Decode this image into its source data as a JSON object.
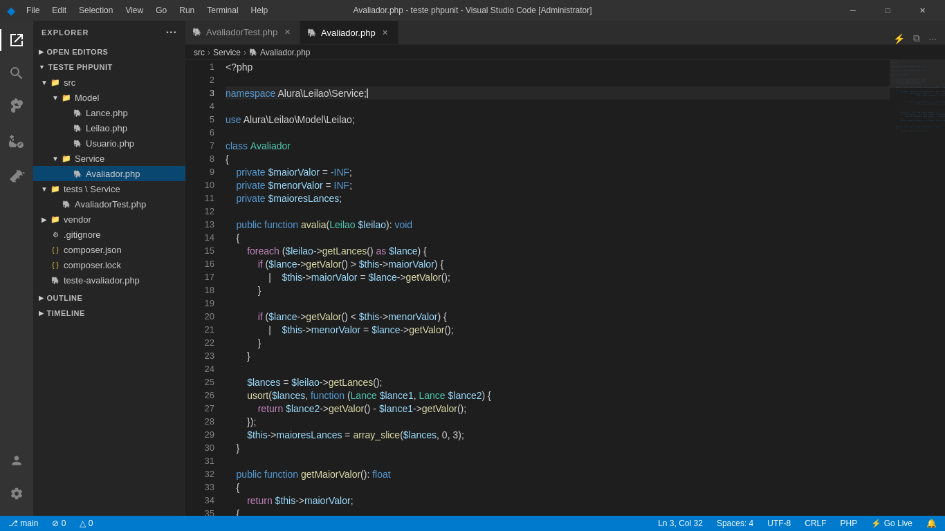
{
  "titleBar": {
    "title": "Avaliador.php - teste phpunit - Visual Studio Code [Administrator]",
    "menus": [
      "File",
      "Edit",
      "Selection",
      "View",
      "Go",
      "Run",
      "Terminal",
      "Help"
    ],
    "winButtons": [
      "─",
      "□",
      "✕"
    ]
  },
  "sidebar": {
    "header": "Explorer",
    "headerDots": "···",
    "sections": {
      "openEditors": "Open Editors",
      "project": "TESTE PHPUNIT"
    },
    "openEditorFiles": [
      {
        "name": "AvaliadorTest.php",
        "icon": "php"
      },
      {
        "name": "Avaliador.php",
        "icon": "php",
        "active": true
      }
    ],
    "tree": [
      {
        "indent": 0,
        "type": "folder",
        "open": true,
        "name": "src"
      },
      {
        "indent": 1,
        "type": "folder",
        "open": true,
        "name": "Model"
      },
      {
        "indent": 2,
        "type": "file",
        "name": "Lance.php",
        "icon": "php"
      },
      {
        "indent": 2,
        "type": "file",
        "name": "Leilao.php",
        "icon": "php"
      },
      {
        "indent": 2,
        "type": "file",
        "name": "Usuario.php",
        "icon": "php"
      },
      {
        "indent": 1,
        "type": "folder",
        "open": true,
        "name": "Service"
      },
      {
        "indent": 2,
        "type": "file",
        "name": "Avaliador.php",
        "icon": "php",
        "selected": true
      },
      {
        "indent": 0,
        "type": "folder",
        "open": true,
        "name": "tests \\ Service"
      },
      {
        "indent": 1,
        "type": "file",
        "name": "AvaliadorTest.php",
        "icon": "php"
      },
      {
        "indent": 0,
        "type": "folder",
        "open": false,
        "name": "vendor"
      },
      {
        "indent": 0,
        "type": "file",
        "name": ".gitignore",
        "icon": "git"
      },
      {
        "indent": 0,
        "type": "file",
        "name": "composer.json",
        "icon": "json"
      },
      {
        "indent": 0,
        "type": "file",
        "name": "composer.lock",
        "icon": "json"
      },
      {
        "indent": 0,
        "type": "file",
        "name": "teste-avaliador.php",
        "icon": "php"
      }
    ],
    "outlineSection": "Outline",
    "timelineSection": "Timeline"
  },
  "tabs": [
    {
      "name": "AvaliadorTest.php",
      "icon": "php",
      "active": false
    },
    {
      "name": "Avaliador.php",
      "icon": "php",
      "active": true,
      "modified": false
    }
  ],
  "breadcrumb": {
    "parts": [
      "src",
      "Service",
      "Avaliador.php"
    ]
  },
  "editor": {
    "filename": "Avaliador.php",
    "lines": [
      {
        "num": 1,
        "code": [
          {
            "t": "plain",
            "v": "<?php"
          }
        ]
      },
      {
        "num": 2,
        "code": []
      },
      {
        "num": 3,
        "code": [
          {
            "t": "kw",
            "v": "namespace"
          },
          {
            "t": "plain",
            "v": " Alura\\Leilao\\Service;"
          },
          {
            "t": "cursor",
            "v": ""
          }
        ]
      },
      {
        "num": 4,
        "code": []
      },
      {
        "num": 5,
        "code": [
          {
            "t": "kw",
            "v": "use"
          },
          {
            "t": "plain",
            "v": " Alura\\Leilao\\Model\\Leilao;"
          }
        ]
      },
      {
        "num": 6,
        "code": []
      },
      {
        "num": 7,
        "code": [
          {
            "t": "kw",
            "v": "class"
          },
          {
            "t": "plain",
            "v": " "
          },
          {
            "t": "cls",
            "v": "Avaliador"
          }
        ]
      },
      {
        "num": 8,
        "code": [
          {
            "t": "plain",
            "v": "{"
          }
        ]
      },
      {
        "num": 9,
        "code": [
          {
            "t": "plain",
            "v": "    "
          },
          {
            "t": "kw",
            "v": "private"
          },
          {
            "t": "plain",
            "v": " "
          },
          {
            "t": "var",
            "v": "$maiorValor"
          },
          {
            "t": "plain",
            "v": " = "
          },
          {
            "t": "kw",
            "v": "-INF"
          },
          {
            "t": "plain",
            "v": ";"
          }
        ]
      },
      {
        "num": 10,
        "code": [
          {
            "t": "plain",
            "v": "    "
          },
          {
            "t": "kw",
            "v": "private"
          },
          {
            "t": "plain",
            "v": " "
          },
          {
            "t": "var",
            "v": "$menorValor"
          },
          {
            "t": "plain",
            "v": " = "
          },
          {
            "t": "kw",
            "v": "INF"
          },
          {
            "t": "plain",
            "v": ";"
          }
        ]
      },
      {
        "num": 11,
        "code": [
          {
            "t": "plain",
            "v": "    "
          },
          {
            "t": "kw",
            "v": "private"
          },
          {
            "t": "plain",
            "v": " "
          },
          {
            "t": "var",
            "v": "$maioresLances"
          },
          {
            "t": "plain",
            "v": ";"
          }
        ]
      },
      {
        "num": 12,
        "code": []
      },
      {
        "num": 13,
        "code": [
          {
            "t": "plain",
            "v": "    "
          },
          {
            "t": "kw",
            "v": "public"
          },
          {
            "t": "plain",
            "v": " "
          },
          {
            "t": "kw",
            "v": "function"
          },
          {
            "t": "plain",
            "v": " "
          },
          {
            "t": "fn",
            "v": "avalia"
          },
          {
            "t": "plain",
            "v": "("
          },
          {
            "t": "cls",
            "v": "Leilao"
          },
          {
            "t": "plain",
            "v": " "
          },
          {
            "t": "var",
            "v": "$leilao"
          },
          {
            "t": "plain",
            "v": "): "
          },
          {
            "t": "kw",
            "v": "void"
          }
        ]
      },
      {
        "num": 14,
        "code": [
          {
            "t": "plain",
            "v": "    {"
          }
        ]
      },
      {
        "num": 15,
        "code": [
          {
            "t": "plain",
            "v": "        "
          },
          {
            "t": "kw2",
            "v": "foreach"
          },
          {
            "t": "plain",
            "v": " ("
          },
          {
            "t": "var",
            "v": "$leilao"
          },
          {
            "t": "plain",
            "v": "->"
          },
          {
            "t": "fn",
            "v": "getLances"
          },
          {
            "t": "plain",
            "v": "() "
          },
          {
            "t": "kw2",
            "v": "as"
          },
          {
            "t": "plain",
            "v": " "
          },
          {
            "t": "var",
            "v": "$lance"
          },
          {
            "t": "plain",
            "v": ") {"
          }
        ]
      },
      {
        "num": 16,
        "code": [
          {
            "t": "plain",
            "v": "            "
          },
          {
            "t": "kw2",
            "v": "if"
          },
          {
            "t": "plain",
            "v": " ("
          },
          {
            "t": "var",
            "v": "$lance"
          },
          {
            "t": "plain",
            "v": "->"
          },
          {
            "t": "fn",
            "v": "getValor"
          },
          {
            "t": "plain",
            "v": "() > "
          },
          {
            "t": "var",
            "v": "$this"
          },
          {
            "t": "plain",
            "v": "->"
          },
          {
            "t": "var",
            "v": "maiorValor"
          },
          {
            "t": "plain",
            "v": ") {"
          }
        ]
      },
      {
        "num": 17,
        "code": [
          {
            "t": "plain",
            "v": "                |    "
          },
          {
            "t": "var",
            "v": "$this"
          },
          {
            "t": "plain",
            "v": "->"
          },
          {
            "t": "var",
            "v": "maiorValor"
          },
          {
            "t": "plain",
            "v": " = "
          },
          {
            "t": "var",
            "v": "$lance"
          },
          {
            "t": "plain",
            "v": "->"
          },
          {
            "t": "fn",
            "v": "getValor"
          },
          {
            "t": "plain",
            "v": "();"
          }
        ]
      },
      {
        "num": 18,
        "code": [
          {
            "t": "plain",
            "v": "            }"
          }
        ]
      },
      {
        "num": 19,
        "code": []
      },
      {
        "num": 20,
        "code": [
          {
            "t": "plain",
            "v": "            "
          },
          {
            "t": "kw2",
            "v": "if"
          },
          {
            "t": "plain",
            "v": " ("
          },
          {
            "t": "var",
            "v": "$lance"
          },
          {
            "t": "plain",
            "v": "->"
          },
          {
            "t": "fn",
            "v": "getValor"
          },
          {
            "t": "plain",
            "v": "() < "
          },
          {
            "t": "var",
            "v": "$this"
          },
          {
            "t": "plain",
            "v": "->"
          },
          {
            "t": "var",
            "v": "menorValor"
          },
          {
            "t": "plain",
            "v": ") {"
          }
        ]
      },
      {
        "num": 21,
        "code": [
          {
            "t": "plain",
            "v": "                |    "
          },
          {
            "t": "var",
            "v": "$this"
          },
          {
            "t": "plain",
            "v": "->"
          },
          {
            "t": "var",
            "v": "menorValor"
          },
          {
            "t": "plain",
            "v": " = "
          },
          {
            "t": "var",
            "v": "$lance"
          },
          {
            "t": "plain",
            "v": "->"
          },
          {
            "t": "fn",
            "v": "getValor"
          },
          {
            "t": "plain",
            "v": "();"
          }
        ]
      },
      {
        "num": 22,
        "code": [
          {
            "t": "plain",
            "v": "            }"
          }
        ]
      },
      {
        "num": 23,
        "code": [
          {
            "t": "plain",
            "v": "        }"
          }
        ]
      },
      {
        "num": 24,
        "code": []
      },
      {
        "num": 25,
        "code": [
          {
            "t": "plain",
            "v": "        "
          },
          {
            "t": "var",
            "v": "$lances"
          },
          {
            "t": "plain",
            "v": " = "
          },
          {
            "t": "var",
            "v": "$leilao"
          },
          {
            "t": "plain",
            "v": "->"
          },
          {
            "t": "fn",
            "v": "getLances"
          },
          {
            "t": "plain",
            "v": "();"
          }
        ]
      },
      {
        "num": 26,
        "code": [
          {
            "t": "plain",
            "v": "        "
          },
          {
            "t": "fn",
            "v": "usort"
          },
          {
            "t": "plain",
            "v": "("
          },
          {
            "t": "var",
            "v": "$lances"
          },
          {
            "t": "plain",
            "v": ", "
          },
          {
            "t": "kw",
            "v": "function"
          },
          {
            "t": "plain",
            "v": " ("
          },
          {
            "t": "cls",
            "v": "Lance"
          },
          {
            "t": "plain",
            "v": " "
          },
          {
            "t": "var",
            "v": "$lance1"
          },
          {
            "t": "plain",
            "v": ", "
          },
          {
            "t": "cls",
            "v": "Lance"
          },
          {
            "t": "plain",
            "v": " "
          },
          {
            "t": "var",
            "v": "$lance2"
          },
          {
            "t": "plain",
            "v": ") {"
          }
        ]
      },
      {
        "num": 27,
        "code": [
          {
            "t": "plain",
            "v": "            "
          },
          {
            "t": "kw2",
            "v": "return"
          },
          {
            "t": "plain",
            "v": " "
          },
          {
            "t": "var",
            "v": "$lance2"
          },
          {
            "t": "plain",
            "v": "->"
          },
          {
            "t": "fn",
            "v": "getValor"
          },
          {
            "t": "plain",
            "v": "() - "
          },
          {
            "t": "var",
            "v": "$lance1"
          },
          {
            "t": "plain",
            "v": "->"
          },
          {
            "t": "fn",
            "v": "getValor"
          },
          {
            "t": "plain",
            "v": "();"
          }
        ]
      },
      {
        "num": 28,
        "code": [
          {
            "t": "plain",
            "v": "        });"
          }
        ]
      },
      {
        "num": 29,
        "code": [
          {
            "t": "plain",
            "v": "        "
          },
          {
            "t": "var",
            "v": "$this"
          },
          {
            "t": "plain",
            "v": "->"
          },
          {
            "t": "var",
            "v": "maioresLances"
          },
          {
            "t": "plain",
            "v": " = "
          },
          {
            "t": "fn",
            "v": "array_slice"
          },
          {
            "t": "plain",
            "v": "("
          },
          {
            "t": "var",
            "v": "$lances"
          },
          {
            "t": "plain",
            "v": ", 0, 3);"
          }
        ]
      },
      {
        "num": 30,
        "code": [
          {
            "t": "plain",
            "v": "    }"
          }
        ]
      },
      {
        "num": 31,
        "code": []
      },
      {
        "num": 32,
        "code": [
          {
            "t": "plain",
            "v": "    "
          },
          {
            "t": "kw",
            "v": "public"
          },
          {
            "t": "plain",
            "v": " "
          },
          {
            "t": "kw",
            "v": "function"
          },
          {
            "t": "plain",
            "v": " "
          },
          {
            "t": "fn",
            "v": "getMaiorValor"
          },
          {
            "t": "plain",
            "v": "(): "
          },
          {
            "t": "kw",
            "v": "float"
          }
        ]
      },
      {
        "num": 33,
        "code": [
          {
            "t": "plain",
            "v": "    {"
          }
        ]
      },
      {
        "num": 34,
        "code": [
          {
            "t": "plain",
            "v": "        "
          },
          {
            "t": "kw2",
            "v": "return"
          },
          {
            "t": "plain",
            "v": " "
          },
          {
            "t": "var",
            "v": "$this"
          },
          {
            "t": "plain",
            "v": "->"
          },
          {
            "t": "var",
            "v": "maiorValor"
          },
          {
            "t": "plain",
            "v": ";"
          }
        ]
      },
      {
        "num": 35,
        "code": [
          {
            "t": "plain",
            "v": "    {"
          }
        ]
      }
    ]
  },
  "statusBar": {
    "left": {
      "gitBranch": "⎇  main",
      "errors": "⊘ 0",
      "warnings": "△ 0"
    },
    "right": {
      "position": "Ln 3, Col 32",
      "spaces": "Spaces: 4",
      "encoding": "UTF-8",
      "lineEnding": "CRLF",
      "language": "PHP",
      "goLive": "⚡ Go Live",
      "notifications": "🔔"
    }
  },
  "colors": {
    "accent": "#007acc",
    "sidebar_bg": "#252526",
    "editor_bg": "#1e1e1e",
    "tab_active_bg": "#1e1e1e",
    "tab_inactive_bg": "#2d2d2d"
  }
}
